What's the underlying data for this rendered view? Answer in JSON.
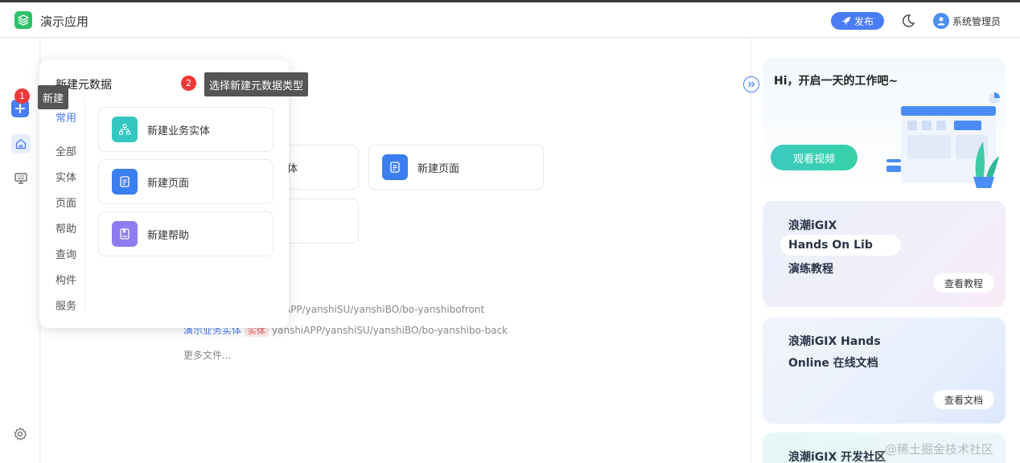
{
  "header": {
    "app_title": "演示应用",
    "publish_label": "发布",
    "user_name": "系统管理员"
  },
  "rail": {
    "icons": [
      "plus-icon",
      "home-icon",
      "monitor-icon",
      "gear-icon"
    ]
  },
  "popup": {
    "title": "新建元数据",
    "categories": [
      "常用",
      "全部",
      "实体",
      "页面",
      "帮助",
      "查询",
      "构件",
      "服务"
    ],
    "active_category": "常用",
    "items": [
      {
        "label": "新建业务实体",
        "icon": "hierarchy-icon",
        "color": "#33c7c2"
      },
      {
        "label": "新建页面",
        "icon": "page-icon",
        "color": "#3a7ef0"
      },
      {
        "label": "新建帮助",
        "icon": "help-book-icon",
        "color": "#8f7cf0"
      }
    ]
  },
  "guide": {
    "step1_number": "1",
    "step1_text": "新建",
    "step2_number": "2",
    "step2_text": "选择新建元数据类型"
  },
  "main": {
    "cards": [
      {
        "label": "体",
        "color": "#33c7c2"
      },
      {
        "label": "新建页面",
        "color": "#3a7ef0"
      }
    ],
    "recent_files": [
      {
        "text": "hiAPP/yanshiSU/yanshiBO/bo-yanshibofront"
      },
      {
        "link": "演示业务实体",
        "tag": "实体",
        "path": "yanshiAPP/yanshiSU/yanshiBO/bo-yanshibo-back"
      }
    ],
    "more_files": "更多文件..."
  },
  "right_panel": {
    "welcome_title": "Hi，开启一天的工作吧~",
    "video_button": "观看视频",
    "promo1_lines": [
      "浪潮iGIX",
      "Hands On Lib",
      "演练教程"
    ],
    "promo1_button": "查看教程",
    "promo2_lines": [
      "浪潮iGIX Hands",
      "Online 在线文档"
    ],
    "promo2_button": "查看文档",
    "promo3_line": "浪潮iGIX 开发社区"
  },
  "watermark": "@稀土掘金技术社区",
  "colors": {
    "accent": "#4a7cf5",
    "badge": "#f0393b",
    "logo": "#2fc06b"
  }
}
